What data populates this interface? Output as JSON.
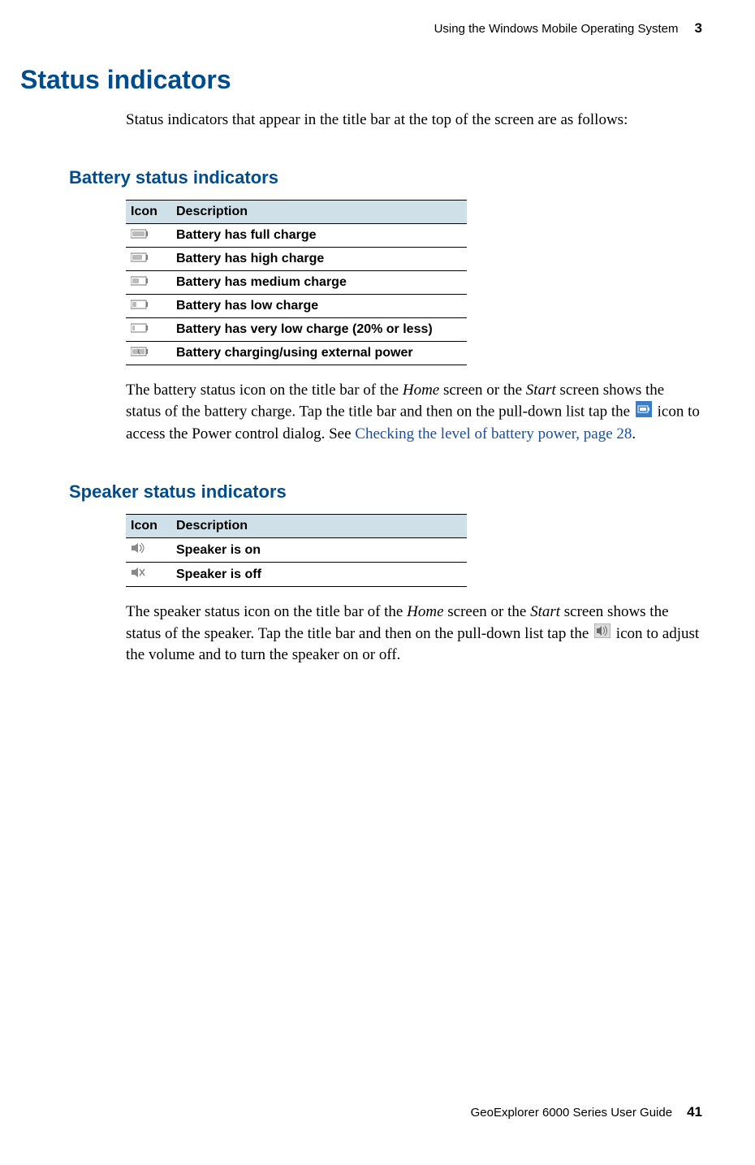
{
  "header": {
    "chapter_title": "Using the Windows Mobile Operating System",
    "chapter_num": "3"
  },
  "section": {
    "title": "Status indicators",
    "intro": "Status indicators that appear in the title bar at the top of the screen are as follows:"
  },
  "battery": {
    "title": "Battery status indicators",
    "header_icon": "Icon",
    "header_desc": "Description",
    "rows": [
      {
        "icon": "battery-full-icon",
        "desc": "Battery has full charge"
      },
      {
        "icon": "battery-high-icon",
        "desc": "Battery has high charge"
      },
      {
        "icon": "battery-medium-icon",
        "desc": "Battery has medium charge"
      },
      {
        "icon": "battery-low-icon",
        "desc": "Battery has low charge"
      },
      {
        "icon": "battery-verylow-icon",
        "desc": "Battery has very low charge (20% or less)"
      },
      {
        "icon": "battery-charging-icon",
        "desc": "Battery charging/using external power"
      }
    ],
    "para_part1": "The battery status icon on the title bar of the ",
    "para_home": "Home",
    "para_part2": " screen or the ",
    "para_start": "Start",
    "para_part3": " screen shows the status of the battery charge. Tap the title bar and then on the pull-down list tap the ",
    "para_part4": " icon to access the Power control dialog. See ",
    "para_link": "Checking the level of battery power, page 28",
    "para_part5": "."
  },
  "speaker": {
    "title": "Speaker status indicators",
    "header_icon": "Icon",
    "header_desc": "Description",
    "rows": [
      {
        "icon": "speaker-on-icon",
        "desc": "Speaker is on"
      },
      {
        "icon": "speaker-off-icon",
        "desc": "Speaker is off"
      }
    ],
    "para_part1": "The speaker status icon on the title bar of the ",
    "para_home": "Home",
    "para_part2": " screen or the ",
    "para_start": "Start",
    "para_part3": " screen shows the status of the speaker. Tap the title bar and then on the pull-down list tap the ",
    "para_part4": " icon to adjust the volume and to turn the speaker on or off."
  },
  "footer": {
    "book_title": "GeoExplorer 6000 Series User Guide",
    "page_num": "41"
  }
}
